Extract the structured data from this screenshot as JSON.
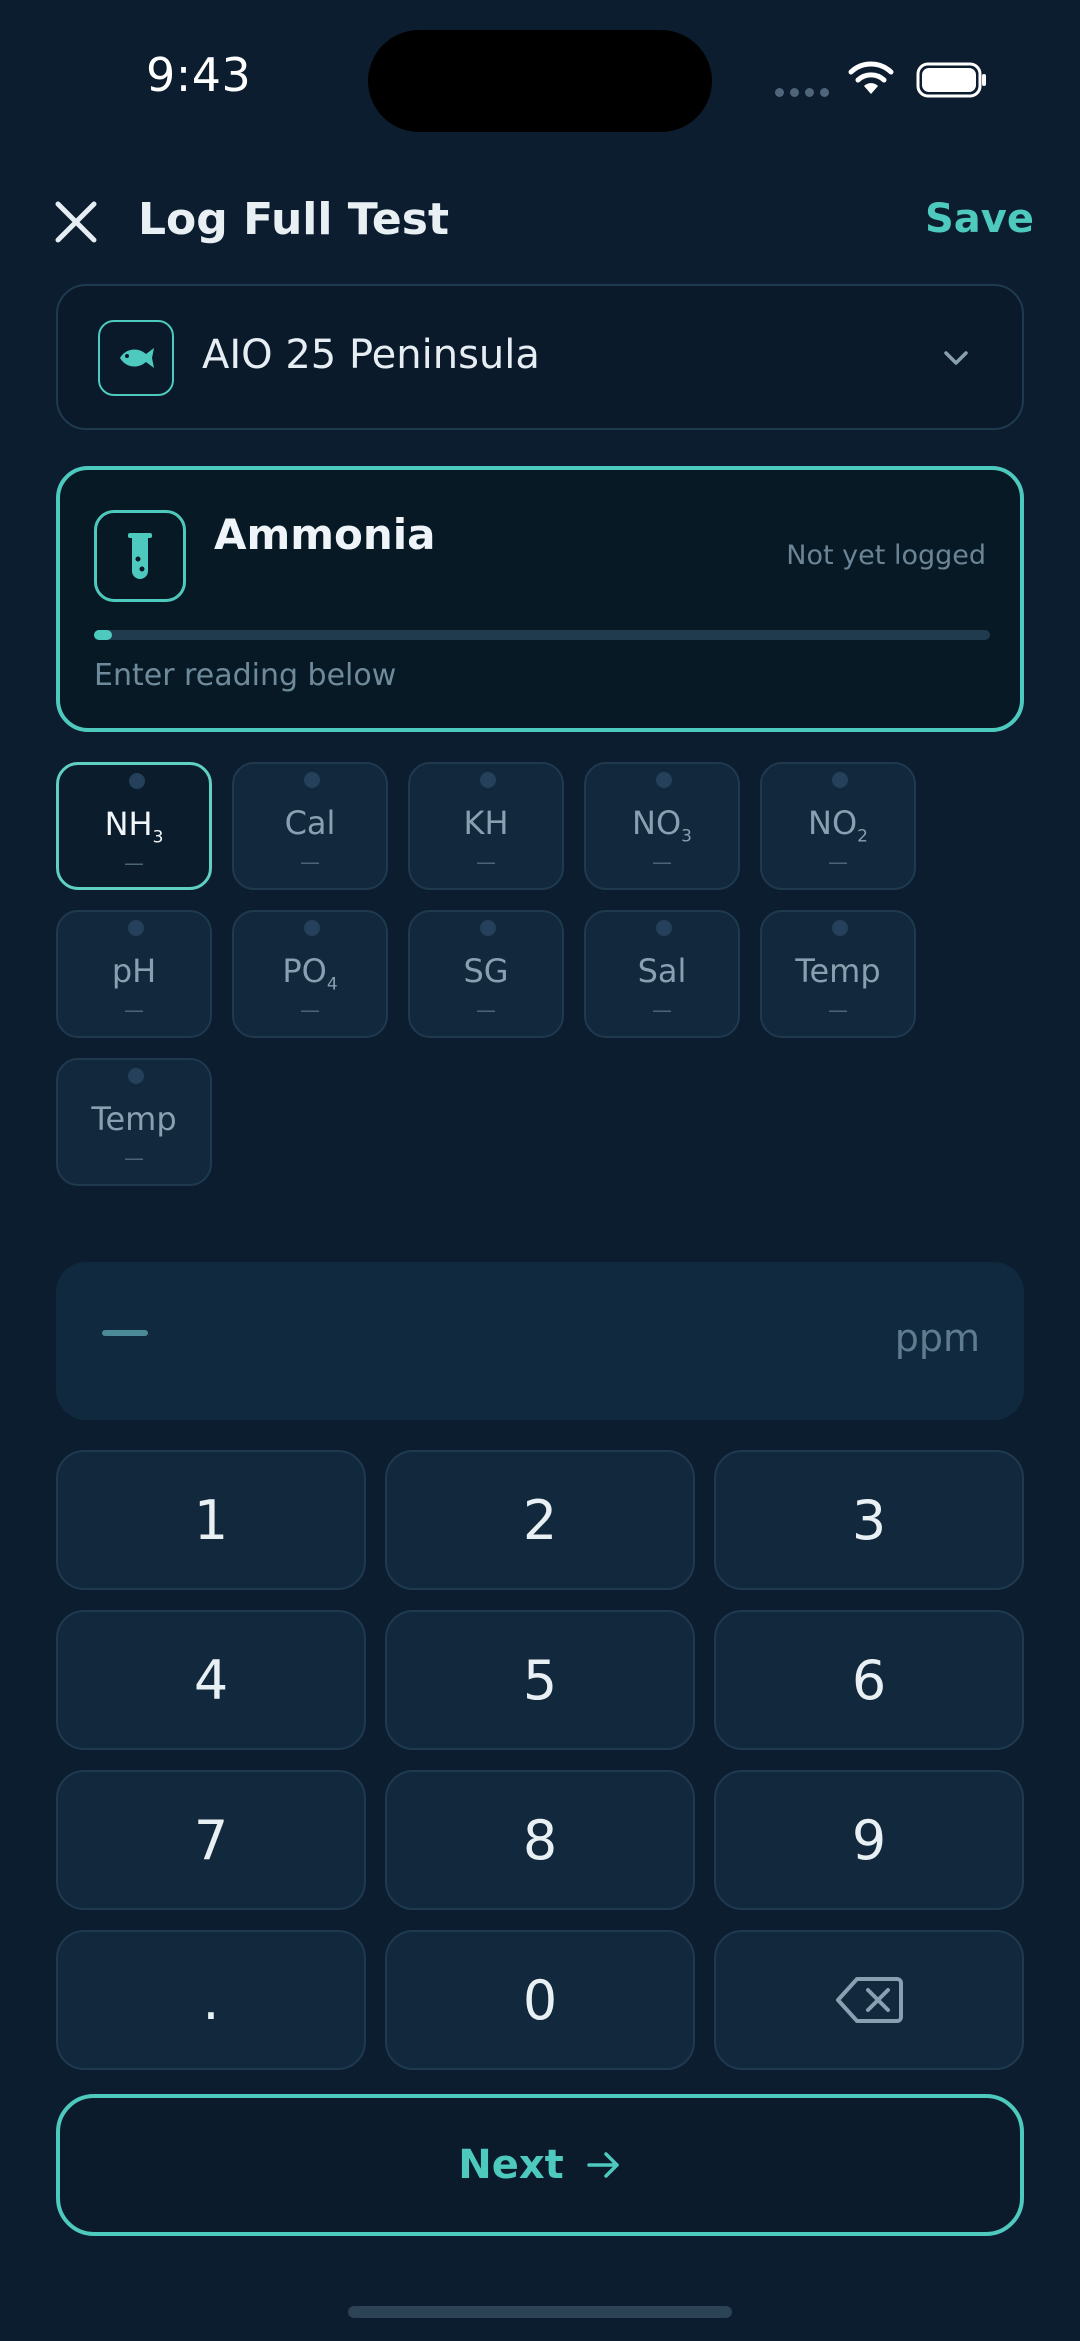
{
  "status_bar": {
    "time": "9:43"
  },
  "header": {
    "title": "Log Full Test",
    "save_label": "Save"
  },
  "tank": {
    "name": "AIO 25 Peninsula",
    "icon": "fish-icon"
  },
  "parameter": {
    "name": "Ammonia",
    "status": "Not yet logged",
    "hint": "Enter reading below",
    "progress": 0.02,
    "icon": "test-tube-icon"
  },
  "chips": [
    {
      "label": "NH",
      "sub": "3",
      "value": "—",
      "active": true
    },
    {
      "label": "Cal",
      "sub": "",
      "value": "—",
      "active": false
    },
    {
      "label": "KH",
      "sub": "",
      "value": "—",
      "active": false
    },
    {
      "label": "NO",
      "sub": "3",
      "value": "—",
      "active": false
    },
    {
      "label": "NO",
      "sub": "2",
      "value": "—",
      "active": false
    },
    {
      "label": "pH",
      "sub": "",
      "value": "—",
      "active": false
    },
    {
      "label": "PO",
      "sub": "4",
      "value": "—",
      "active": false
    },
    {
      "label": "SG",
      "sub": "",
      "value": "—",
      "active": false
    },
    {
      "label": "Sal",
      "sub": "",
      "value": "—",
      "active": false
    },
    {
      "label": "Temp",
      "sub": "",
      "value": "—",
      "active": false
    },
    {
      "label": "Temp",
      "sub": "",
      "value": "—",
      "active": false
    }
  ],
  "reading": {
    "unit": "ppm"
  },
  "keypad": [
    "1",
    "2",
    "3",
    "4",
    "5",
    "6",
    "7",
    "8",
    "9",
    ".",
    "0",
    "⌫"
  ],
  "next": {
    "label": "Next"
  },
  "colors": {
    "accent": "#4ec9be",
    "background": "#0c1d30",
    "key": "#11283d"
  }
}
